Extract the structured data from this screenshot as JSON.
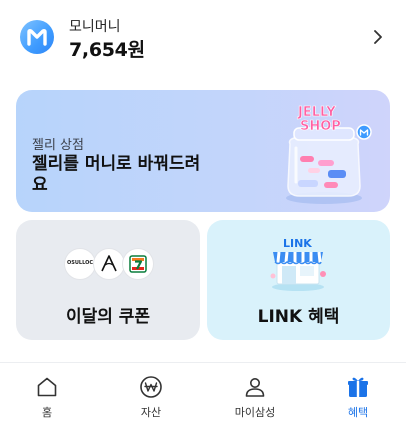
{
  "header": {
    "label": "모니머니",
    "amount": "7,654원",
    "logo_letter": "M",
    "logo_icon": "money-logo-icon",
    "chevron_icon": "chevron-right-icon"
  },
  "jelly_card": {
    "subtitle": "젤리 상점",
    "title": "젤리를 머니로 바꿔드려요",
    "illustration_text": [
      "JELLY",
      "SHOP"
    ],
    "illustration_icon": "jelly-jar-icon"
  },
  "coupon_card": {
    "title": "이달의 쿠폰",
    "logos": [
      "osulloc-logo",
      "ap-logo",
      "seven-eleven-logo"
    ],
    "osulloc_text": "OSULLOC"
  },
  "link_card": {
    "title": "LINK 혜택",
    "illustration_text": "LINK",
    "illustration_icon": "store-icon"
  },
  "tabbar": {
    "tabs": [
      {
        "label": "홈",
        "icon": "home-icon",
        "active": false
      },
      {
        "label": "자산",
        "icon": "won-icon",
        "active": false
      },
      {
        "label": "마이삼성",
        "icon": "person-icon",
        "active": false
      },
      {
        "label": "혜택",
        "icon": "gift-icon",
        "active": true
      }
    ]
  },
  "colors": {
    "accent": "#1b73e8",
    "logo_blue": "#3e9bff",
    "jelly_card_bg": "#bfd5fb",
    "coupon_card_bg": "#e8ebf0",
    "link_card_bg": "#d9f2fb"
  }
}
